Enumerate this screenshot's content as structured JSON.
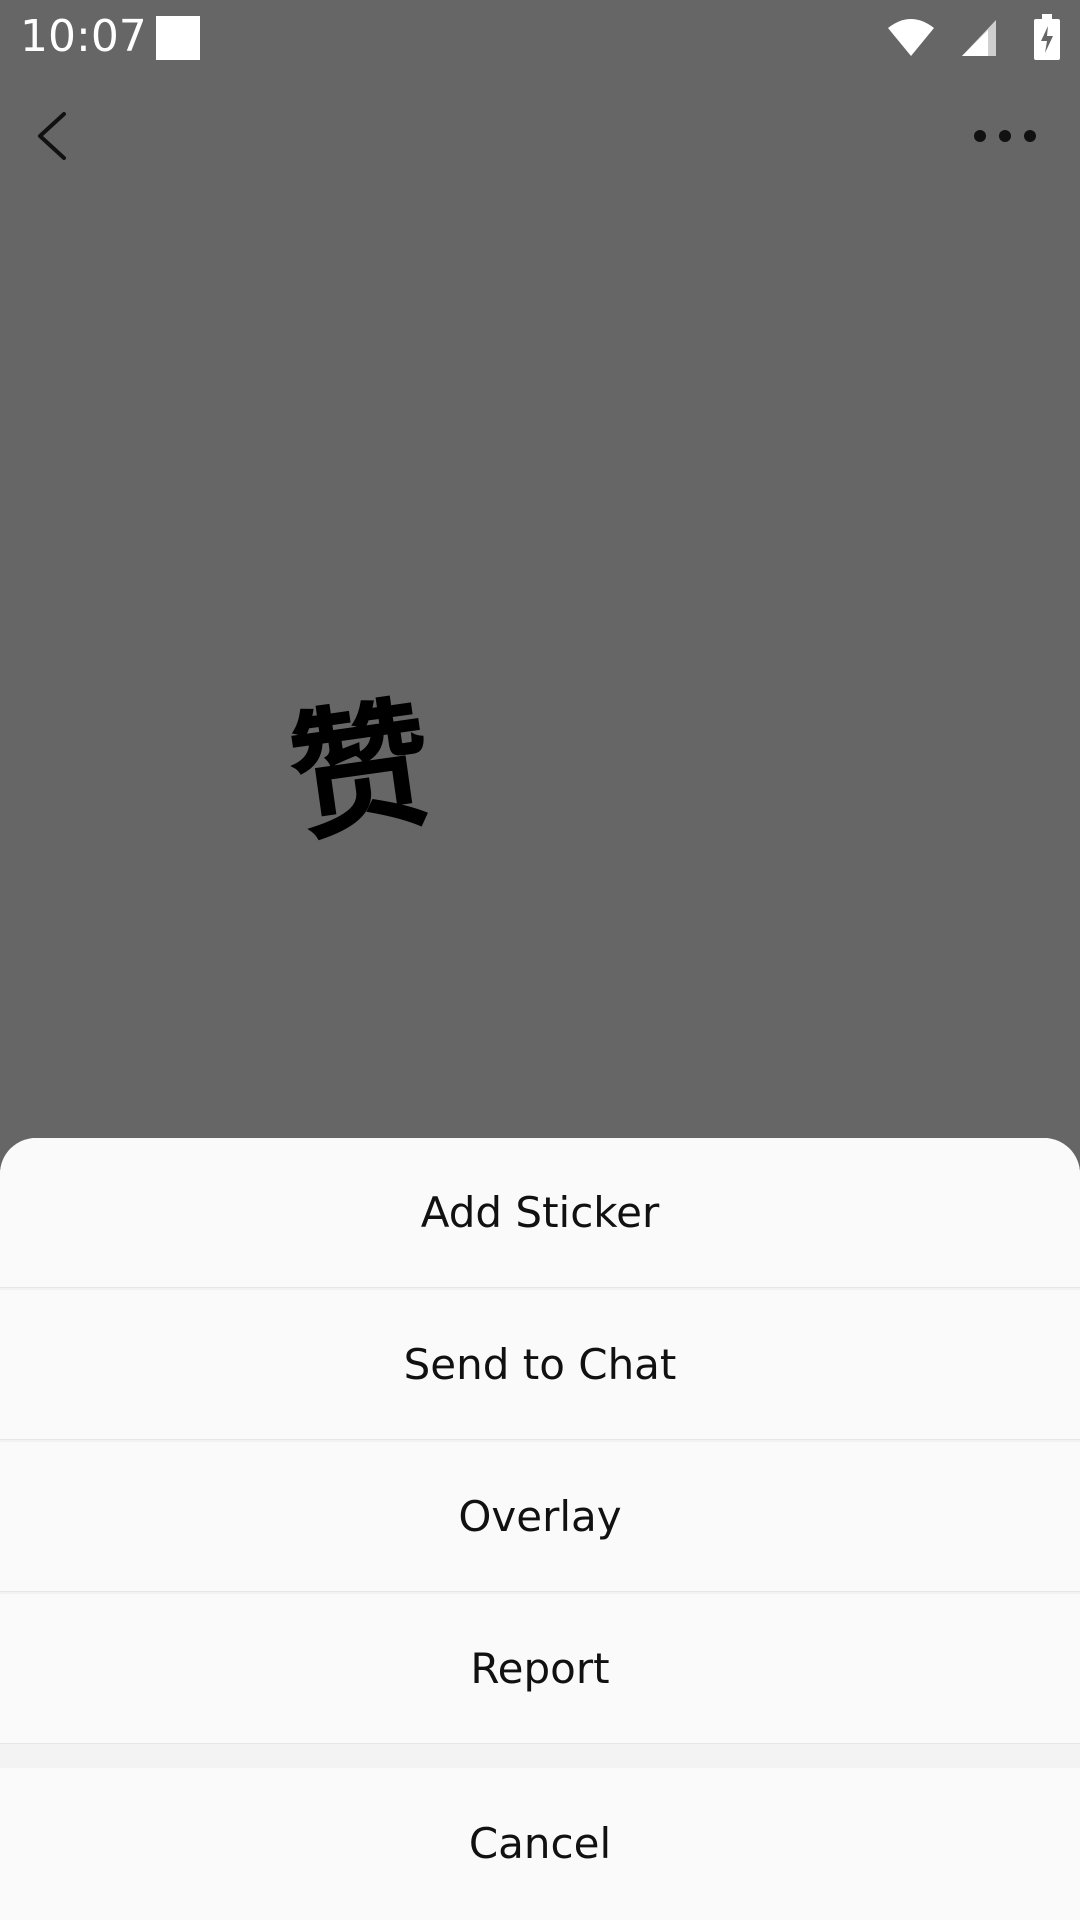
{
  "status_bar": {
    "time": "10:07",
    "icons": [
      "notification-square-icon",
      "wifi-icon",
      "signal-icon",
      "battery-charging-icon"
    ]
  },
  "toolbar": {
    "back_icon": "chevron-left-icon",
    "more_icon": "more-dots-icon"
  },
  "content": {
    "sticker_text": "赞"
  },
  "action_sheet": {
    "items": [
      {
        "label": "Add Sticker"
      },
      {
        "label": "Send to Chat"
      },
      {
        "label": "Overlay"
      },
      {
        "label": "Report"
      }
    ],
    "cancel_label": "Cancel"
  },
  "colors": {
    "background": "#666666",
    "sheet_background": "#fafafa",
    "separator": "#e6e6e6",
    "text": "#111111"
  }
}
